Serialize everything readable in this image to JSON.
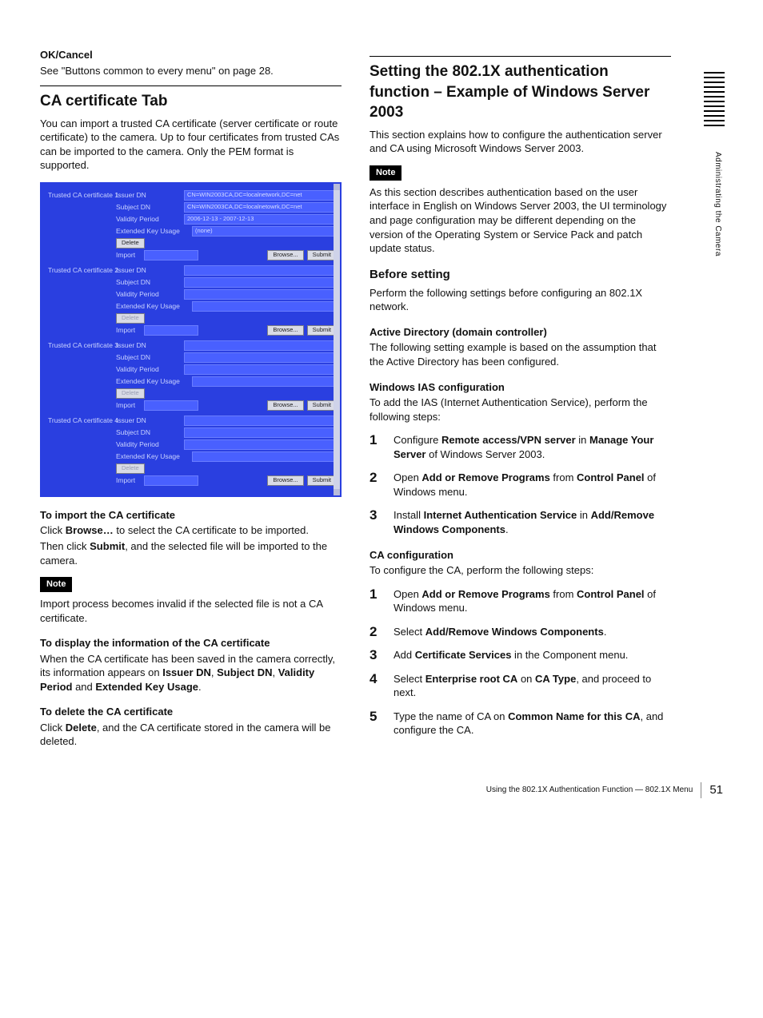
{
  "left": {
    "okCancelLabel": "OK/Cancel",
    "okCancelBody": "See \"Buttons common to every menu\" on page 28.",
    "h1": "CA certificate Tab",
    "p1": "You can import a trusted CA certificate (server certificate or route certificate) to the camera. Up to four certificates from trusted CAs can be imported to the camera. Only the PEM format is supported.",
    "screenshot": {
      "rowLabels": {
        "issuer": "Issuer DN",
        "subject": "Subject DN",
        "validity": "Validity Period",
        "eku": "Extended Key Usage",
        "import": "Import"
      },
      "buttons": {
        "delete": "Delete",
        "browse": "Browse...",
        "submit": "Submit"
      },
      "certs": [
        {
          "title": "Trusted CA certificate 1",
          "issuer": "CN=WIN2003CA,DC=localnetwork,DC=net",
          "subject": "CN=WIN2003CA,DC=localnetowrk,DC=net",
          "validity": "2006-12-13 - 2007-12-13",
          "eku": "(none)",
          "deleteDisabled": false
        },
        {
          "title": "Trusted CA certificate 2",
          "issuer": "",
          "subject": "",
          "validity": "",
          "eku": "",
          "deleteDisabled": true
        },
        {
          "title": "Trusted CA certificate 3",
          "issuer": "",
          "subject": "",
          "validity": "",
          "eku": "",
          "deleteDisabled": true
        },
        {
          "title": "Trusted CA certificate 4",
          "issuer": "",
          "subject": "",
          "validity": "",
          "eku": "",
          "deleteDisabled": true
        }
      ]
    },
    "importHeading": "To import the CA certificate",
    "importBody1a": "Click ",
    "importBody1b": "Browse…",
    "importBody1c": " to select the CA certificate to be imported.",
    "importBody2a": "Then click ",
    "importBody2b": "Submit",
    "importBody2c": ", and the selected file will be imported to the camera.",
    "note1": "Note",
    "note1Body": "Import process becomes invalid if the selected file is not a CA certificate.",
    "displayHeading": "To display the information of the CA certificate",
    "displayBodyA": "When the CA certificate has been saved in the camera correctly, its information appears on ",
    "displayBodyB": "Issuer DN",
    "displayBodyC": ", ",
    "displayBodyD": "Subject DN",
    "displayBodyE": ", ",
    "displayBodyF": "Validity Period",
    "displayBodyG": " and ",
    "displayBodyH": "Extended Key Usage",
    "displayBodyI": ".",
    "deleteHeading": "To delete the CA certificate",
    "deleteBodyA": "Click ",
    "deleteBodyB": "Delete",
    "deleteBodyC": ", and the CA certificate stored in the camera will be deleted."
  },
  "right": {
    "h1": "Setting the 802.1X authentication function – Example of Windows Server 2003",
    "p1": "This section explains how to configure the authentication server and CA using Microsoft Windows Server 2003.",
    "note1": "Note",
    "note1Body": "As this section describes authentication based on the user interface in English on Windows Server 2003, the UI terminology and page configuration may be different depending on the version of the Operating System or Service Pack and patch update status.",
    "beforeHeading": "Before setting",
    "beforeBody": "Perform the following settings before configuring an 802.1X network.",
    "adHeading": "Active Directory (domain controller)",
    "adBody": "The following setting example is based on the assumption that the Active Directory has been configured.",
    "iasHeading": "Windows IAS configuration",
    "iasBody": "To add the IAS (Internet Authentication Service), perform the following steps:",
    "iasSteps": [
      {
        "a": "Configure ",
        "b": "Remote access/VPN server",
        "c": " in ",
        "d": "Manage Your Server",
        "e": " of Windows Server 2003."
      },
      {
        "a": "Open ",
        "b": "Add or Remove Programs",
        "c": " from ",
        "d": "Control Panel",
        "e": " of Windows menu."
      },
      {
        "a": "Install ",
        "b": "Internet Authentication Service",
        "c": " in ",
        "d": "Add/Remove Windows Components",
        "e": "."
      }
    ],
    "caHeading": "CA configuration",
    "caBody": "To configure the CA, perform the following steps:",
    "caSteps": [
      {
        "a": "Open ",
        "b": "Add or Remove Programs",
        "c": " from ",
        "d": "Control Panel",
        "e": " of Windows menu."
      },
      {
        "a": "Select ",
        "b": "Add/Remove Windows Components",
        "c": ".",
        "d": "",
        "e": ""
      },
      {
        "a": "Add ",
        "b": "Certificate Services",
        "c": " in the Component menu.",
        "d": "",
        "e": ""
      },
      {
        "a": "Select ",
        "b": "Enterprise root CA",
        "c": " on ",
        "d": "CA Type",
        "e": ", and proceed to next."
      },
      {
        "a": "Type the name of CA on ",
        "b": "Common Name for this CA",
        "c": ", and configure the CA.",
        "d": "",
        "e": ""
      }
    ]
  },
  "sideText": "Administrating the Camera",
  "footer": {
    "text": "Using the 802.1X Authentication Function — 802.1X Menu",
    "page": "51"
  }
}
